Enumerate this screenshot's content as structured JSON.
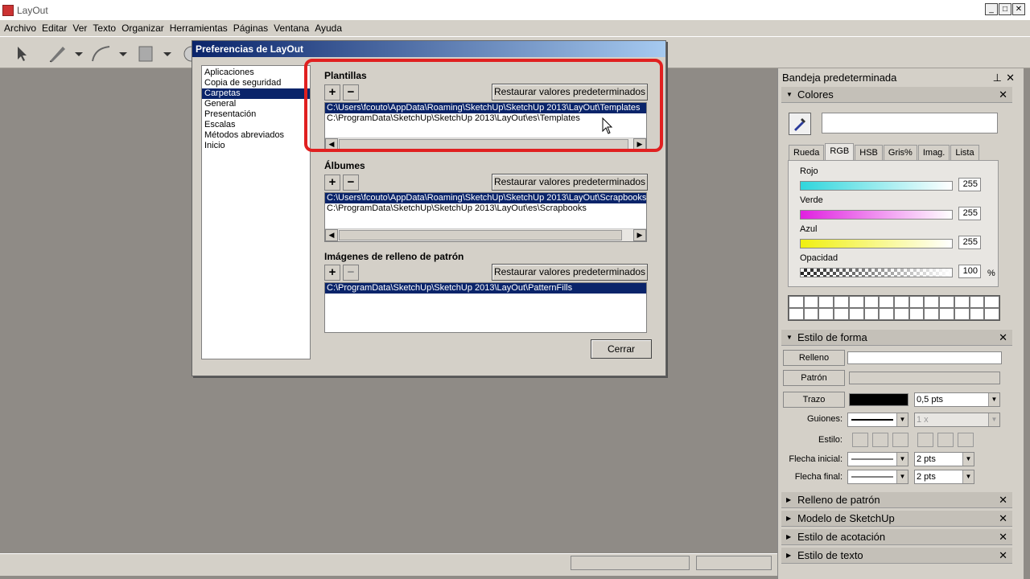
{
  "app": {
    "title": "LayOut"
  },
  "menu": [
    "Archivo",
    "Editar",
    "Ver",
    "Texto",
    "Organizar",
    "Herramientas",
    "Páginas",
    "Ventana",
    "Ayuda"
  ],
  "dialog": {
    "title": "Preferencias de LayOut",
    "nav": [
      "Aplicaciones",
      "Copia de seguridad",
      "Carpetas",
      "General",
      "Presentación",
      "Escalas",
      "Métodos abreviados",
      "Inicio"
    ],
    "nav_selected_index": 2,
    "sections": [
      {
        "title": "Plantillas",
        "restore": "Restaurar valores predeterminados",
        "paths": [
          "C:\\Users\\fcouto\\AppData\\Roaming\\SketchUp\\SketchUp 2013\\LayOut\\Templates",
          "C:\\ProgramData\\SketchUp\\SketchUp 2013\\LayOut\\es\\Templates"
        ]
      },
      {
        "title": "Álbumes",
        "restore": "Restaurar valores predeterminados",
        "paths": [
          "C:\\Users\\fcouto\\AppData\\Roaming\\SketchUp\\SketchUp 2013\\LayOut\\Scrapbooks",
          "C:\\ProgramData\\SketchUp\\SketchUp 2013\\LayOut\\es\\Scrapbooks"
        ]
      },
      {
        "title": "Imágenes de relleno de patrón",
        "restore": "Restaurar valores predeterminados",
        "paths": [
          "C:\\ProgramData\\SketchUp\\SketchUp 2013\\LayOut\\PatternFills"
        ]
      }
    ],
    "plus": "+",
    "minus": "−",
    "close": "Cerrar"
  },
  "tray": {
    "title": "Bandeja predeterminada",
    "colors": {
      "title": "Colores",
      "tabs": [
        "Rueda",
        "RGB",
        "HSB",
        "Gris%",
        "Imag.",
        "Lista"
      ],
      "active_tab": "RGB",
      "sliders": [
        {
          "label": "Rojo",
          "value": "255"
        },
        {
          "label": "Verde",
          "value": "255"
        },
        {
          "label": "Azul",
          "value": "255"
        },
        {
          "label": "Opacidad",
          "value": "100"
        }
      ],
      "percent": "%"
    },
    "shape_style": {
      "title": "Estilo de forma",
      "fill": "Relleno",
      "pattern": "Patrón",
      "stroke": "Trazo",
      "stroke_width": "0,5 pts",
      "dashes_label": "Guiones:",
      "dash_scale": "1 x",
      "style_label": "Estilo:",
      "start_arrow_label": "Flecha inicial:",
      "start_arrow_size": "2 pts",
      "end_arrow_label": "Flecha final:",
      "end_arrow_size": "2 pts"
    },
    "collapsed": [
      "Relleno de patrón",
      "Modelo de SketchUp",
      "Estilo de acotación",
      "Estilo de texto"
    ],
    "close_x": "✕"
  }
}
